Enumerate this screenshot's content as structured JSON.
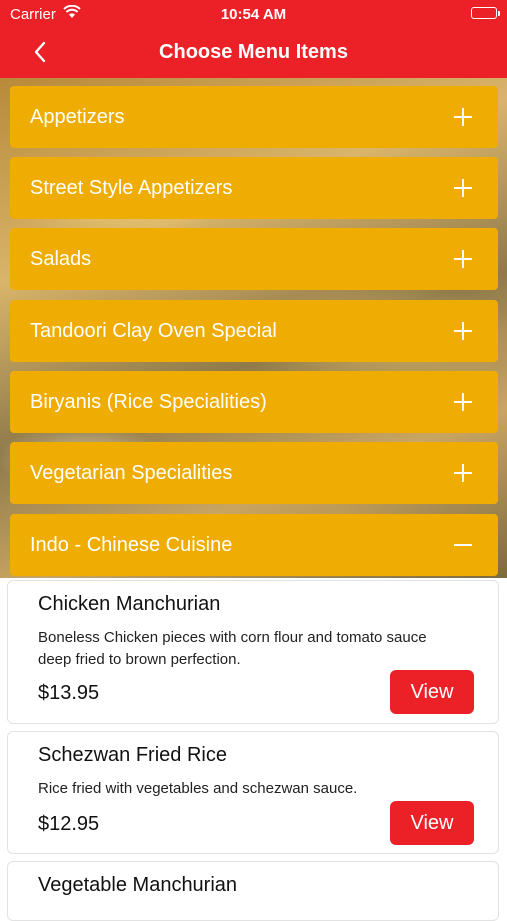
{
  "status_bar": {
    "carrier": "Carrier",
    "time": "10:54 AM"
  },
  "nav": {
    "title": "Choose Menu Items",
    "back_icon": "chevron-left-icon"
  },
  "colors": {
    "primary_red": "#ec2127",
    "category_amber": "#efad04"
  },
  "categories": [
    {
      "label": "Appetizers",
      "state": "collapsed"
    },
    {
      "label": "Street Style Appetizers",
      "state": "collapsed"
    },
    {
      "label": "Salads",
      "state": "collapsed"
    },
    {
      "label": "Tandoori Clay Oven Special",
      "state": "collapsed"
    },
    {
      "label": "Biryanis (Rice Specialities)",
      "state": "collapsed"
    },
    {
      "label": "Vegetarian Specialities",
      "state": "collapsed"
    },
    {
      "label": "Indo - Chinese Cuisine",
      "state": "expanded"
    }
  ],
  "items": [
    {
      "name": "Chicken Manchurian",
      "description": "Boneless Chicken pieces with corn flour and tomato sauce deep fried to brown perfection.",
      "price": "$13.95",
      "button": "View"
    },
    {
      "name": "Schezwan Fried Rice",
      "description": "Rice fried with vegetables and schezwan sauce.",
      "price": "$12.95",
      "button": "View"
    },
    {
      "name": "Vegetable Manchurian"
    }
  ]
}
